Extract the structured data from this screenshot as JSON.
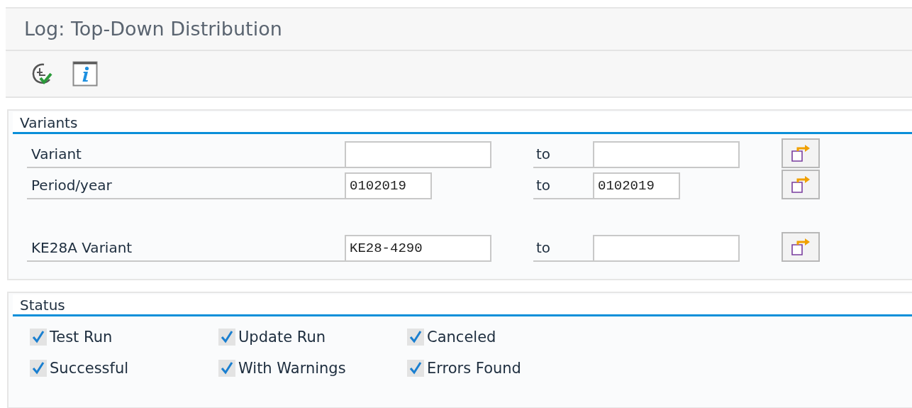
{
  "window": {
    "title": "Log: Top-Down Distribution"
  },
  "toolbar": [
    {
      "kind": "execute"
    },
    {
      "kind": "info"
    }
  ],
  "variants": {
    "title": "Variants",
    "row_groups": [
      [
        {
          "label": "Variant",
          "to_label": "to",
          "wide": true
        },
        {
          "label": "Period/year",
          "from": "0102019",
          "to_label": "to",
          "to": "0102019",
          "wide": false
        }
      ],
      [
        {
          "label": "KE28A Variant",
          "from": "KE28-4290",
          "to_label": "to",
          "wide": true
        }
      ]
    ]
  },
  "status": {
    "title": "Status",
    "options": [
      {
        "label": "Test Run",
        "checked": true
      },
      {
        "label": "Update Run",
        "checked": true
      },
      {
        "label": "Canceled",
        "checked": true
      },
      {
        "label": "Successful",
        "checked": true
      },
      {
        "label": "With Warnings",
        "checked": true
      },
      {
        "label": "Errors Found",
        "checked": true
      }
    ]
  }
}
